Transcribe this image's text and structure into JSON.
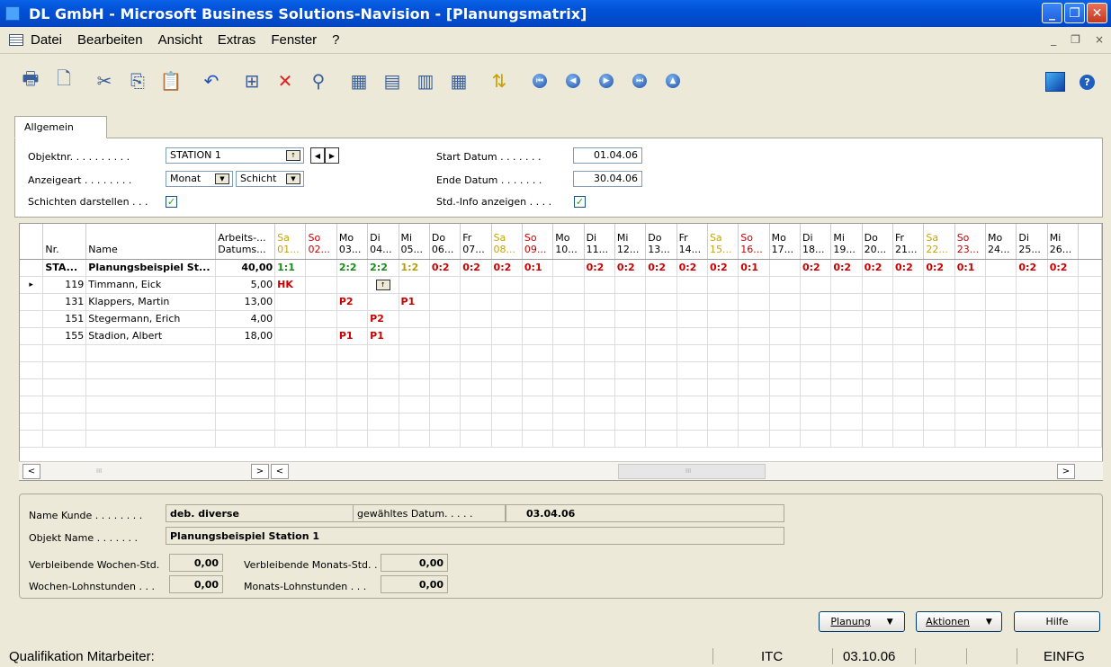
{
  "window": {
    "title": "DL GmbH - Microsoft Business Solutions-Navision - [Planungsmatrix]",
    "min": "_",
    "max": "❐",
    "close": "✕"
  },
  "menu": [
    {
      "label": "Datei"
    },
    {
      "label": "Bearbeiten"
    },
    {
      "label": "Ansicht"
    },
    {
      "label": "Extras"
    },
    {
      "label": "Fenster"
    },
    {
      "label": "?"
    }
  ],
  "mdi": {
    "min": "_",
    "restore": "❐",
    "close": "×"
  },
  "toolbar": [
    {
      "icon": "print-icon",
      "glyph": "🖶"
    },
    {
      "icon": "preview-icon",
      "glyph": "🗋"
    },
    {
      "icon": "cut-icon",
      "glyph": "✂"
    },
    {
      "icon": "copy-icon",
      "glyph": "⎘"
    },
    {
      "icon": "paste-icon",
      "glyph": "📋"
    },
    {
      "icon": "undo-icon",
      "glyph": "↶"
    },
    {
      "icon": "insert-icon",
      "glyph": "⊞"
    },
    {
      "icon": "delete-icon",
      "glyph": "✕"
    },
    {
      "icon": "find-icon",
      "glyph": "⚲"
    },
    {
      "icon": "table-view-icon",
      "glyph": "▦"
    },
    {
      "icon": "form-view-icon",
      "glyph": "▤"
    },
    {
      "icon": "filter-icon",
      "glyph": "▥"
    },
    {
      "icon": "list-icon",
      "glyph": "▦"
    },
    {
      "icon": "sort-icon",
      "glyph": "⇅"
    },
    {
      "icon": "first-record-icon",
      "glyph": "⏮"
    },
    {
      "icon": "prev-record-icon",
      "glyph": "◀"
    },
    {
      "icon": "next-record-icon",
      "glyph": "▶"
    },
    {
      "icon": "last-record-icon",
      "glyph": "⏭"
    },
    {
      "icon": "up-icon",
      "glyph": "▲"
    }
  ],
  "toolbar_right": [
    {
      "icon": "navision-logo-icon"
    },
    {
      "icon": "help-icon",
      "glyph": "?"
    }
  ],
  "tab": {
    "label": "Allgemein"
  },
  "form": {
    "objektnr_label": "Objektnr. . . . . . . . . .",
    "objektnr_value": "STATION 1",
    "anzeigeart_label": "Anzeigeart . . . . . . . .",
    "anzeigeart_value": "Monat",
    "schicht_value": "Schicht",
    "schichten_label": "Schichten darstellen . . .",
    "schichten_checked": "✓",
    "start_label": "Start Datum . . . . . . .",
    "start_value": "01.04.06",
    "ende_label": "Ende Datum . . . . . . .",
    "ende_value": "30.04.06",
    "stdinfo_label": "Std.-Info anzeigen . . . .",
    "stdinfo_checked": "✓"
  },
  "grid": {
    "headers": {
      "nr": "Nr.",
      "name": "Name",
      "arbeits1": "Arbeits-...",
      "arbeits2": "Datums..."
    },
    "days": [
      {
        "d": "Sa",
        "n": "01...",
        "t": "sa"
      },
      {
        "d": "So",
        "n": "02...",
        "t": "so"
      },
      {
        "d": "Mo",
        "n": "03...",
        "t": ""
      },
      {
        "d": "Di",
        "n": "04...",
        "t": ""
      },
      {
        "d": "Mi",
        "n": "05...",
        "t": ""
      },
      {
        "d": "Do",
        "n": "06...",
        "t": ""
      },
      {
        "d": "Fr",
        "n": "07...",
        "t": ""
      },
      {
        "d": "Sa",
        "n": "08...",
        "t": "sa"
      },
      {
        "d": "So",
        "n": "09...",
        "t": "so"
      },
      {
        "d": "Mo",
        "n": "10...",
        "t": ""
      },
      {
        "d": "Di",
        "n": "11...",
        "t": ""
      },
      {
        "d": "Mi",
        "n": "12...",
        "t": ""
      },
      {
        "d": "Do",
        "n": "13...",
        "t": ""
      },
      {
        "d": "Fr",
        "n": "14...",
        "t": ""
      },
      {
        "d": "Sa",
        "n": "15...",
        "t": "sa"
      },
      {
        "d": "So",
        "n": "16...",
        "t": "so"
      },
      {
        "d": "Mo",
        "n": "17...",
        "t": ""
      },
      {
        "d": "Di",
        "n": "18...",
        "t": ""
      },
      {
        "d": "Mi",
        "n": "19...",
        "t": ""
      },
      {
        "d": "Do",
        "n": "20...",
        "t": ""
      },
      {
        "d": "Fr",
        "n": "21...",
        "t": ""
      },
      {
        "d": "Sa",
        "n": "22...",
        "t": "sa"
      },
      {
        "d": "So",
        "n": "23...",
        "t": "so"
      },
      {
        "d": "Mo",
        "n": "24...",
        "t": ""
      },
      {
        "d": "Di",
        "n": "25...",
        "t": ""
      },
      {
        "d": "Mi",
        "n": "26...",
        "t": ""
      }
    ],
    "rows": [
      {
        "nr": "STA...",
        "name": "Planungsbeispiel St...",
        "hours": "40,00",
        "bold": true,
        "cells": [
          {
            "v": "1:1",
            "c": "g"
          },
          {
            "v": "",
            "c": ""
          },
          {
            "v": "2:2",
            "c": "g"
          },
          {
            "v": "2:2",
            "c": "g"
          },
          {
            "v": "1:2",
            "c": "y"
          },
          {
            "v": "0:2",
            "c": "rd"
          },
          {
            "v": "0:2",
            "c": "rd"
          },
          {
            "v": "0:2",
            "c": "rd"
          },
          {
            "v": "0:1",
            "c": "rd"
          },
          {
            "v": "",
            "c": ""
          },
          {
            "v": "0:2",
            "c": "rd"
          },
          {
            "v": "0:2",
            "c": "rd"
          },
          {
            "v": "0:2",
            "c": "rd"
          },
          {
            "v": "0:2",
            "c": "rd"
          },
          {
            "v": "0:2",
            "c": "rd"
          },
          {
            "v": "0:1",
            "c": "rd"
          },
          {
            "v": "",
            "c": ""
          },
          {
            "v": "0:2",
            "c": "rd"
          },
          {
            "v": "0:2",
            "c": "rd"
          },
          {
            "v": "0:2",
            "c": "rd"
          },
          {
            "v": "0:2",
            "c": "rd"
          },
          {
            "v": "0:2",
            "c": "rd"
          },
          {
            "v": "0:1",
            "c": "rd"
          },
          {
            "v": "",
            "c": ""
          },
          {
            "v": "0:2",
            "c": "rd"
          },
          {
            "v": "0:2",
            "c": "rd"
          }
        ],
        "shift": false
      },
      {
        "nr": "119",
        "name": "Timmann, Eick",
        "hours": "5,00",
        "bold": false,
        "cells": [
          {
            "v": "HK",
            "c": "rd"
          },
          {
            "v": "",
            "c": ""
          },
          {
            "v": "",
            "c": ""
          },
          {
            "v": "↑",
            "c": "btn"
          }
        ],
        "shift": true
      },
      {
        "nr": "131",
        "name": "Klappers, Martin",
        "hours": "13,00",
        "bold": false,
        "cells": [
          {
            "v": "",
            "c": ""
          },
          {
            "v": "",
            "c": ""
          },
          {
            "v": "P2",
            "c": "rd"
          },
          {
            "v": "",
            "c": ""
          },
          {
            "v": "P1",
            "c": "rd"
          }
        ]
      },
      {
        "nr": "151",
        "name": "Stegermann, Erich",
        "hours": "4,00",
        "bold": false,
        "cells": [
          {
            "v": "",
            "c": ""
          },
          {
            "v": "",
            "c": ""
          },
          {
            "v": "",
            "c": ""
          },
          {
            "v": "P2",
            "c": "rd"
          }
        ]
      },
      {
        "nr": "155",
        "name": "Stadion, Albert",
        "hours": "18,00",
        "bold": false,
        "cells": [
          {
            "v": "",
            "c": ""
          },
          {
            "v": "",
            "c": ""
          },
          {
            "v": "P1",
            "c": "rd"
          },
          {
            "v": "P1",
            "c": "rd"
          }
        ]
      }
    ],
    "empty_rows": 6,
    "row_marker": "▸",
    "scroll": {
      "left": "<",
      "right": ">",
      "vup": "^",
      "vdown": "v",
      "grip": "III"
    }
  },
  "bottom": {
    "name_kunde_label": "Name Kunde . . . . . . . .",
    "name_kunde_value": "deb. diverse",
    "gew_datum_label": "gewähltes Datum. . . . .",
    "gew_datum_value": "03.04.06",
    "objekt_name_label": "Objekt Name . . . . . . .",
    "objekt_name_value": "Planungsbeispiel Station 1",
    "vw_label": "Verbleibende Wochen-Std.",
    "vw_value": "0,00",
    "vm_label": "Verbleibende Monats-Std. .",
    "vm_value": "0,00",
    "wl_label": "Wochen-Lohnstunden . . .",
    "wl_value": "0,00",
    "ml_label": "Monats-Lohnstunden . . .",
    "ml_value": "0,00"
  },
  "buttons": {
    "planung": "Planung",
    "aktionen": "Aktionen",
    "hilfe": "Hilfe",
    "caret": "▼"
  },
  "status": {
    "left": "Qualifikation Mitarbeiter:",
    "itc": "ITC",
    "date": "03.10.06",
    "mode": "EINFG"
  }
}
